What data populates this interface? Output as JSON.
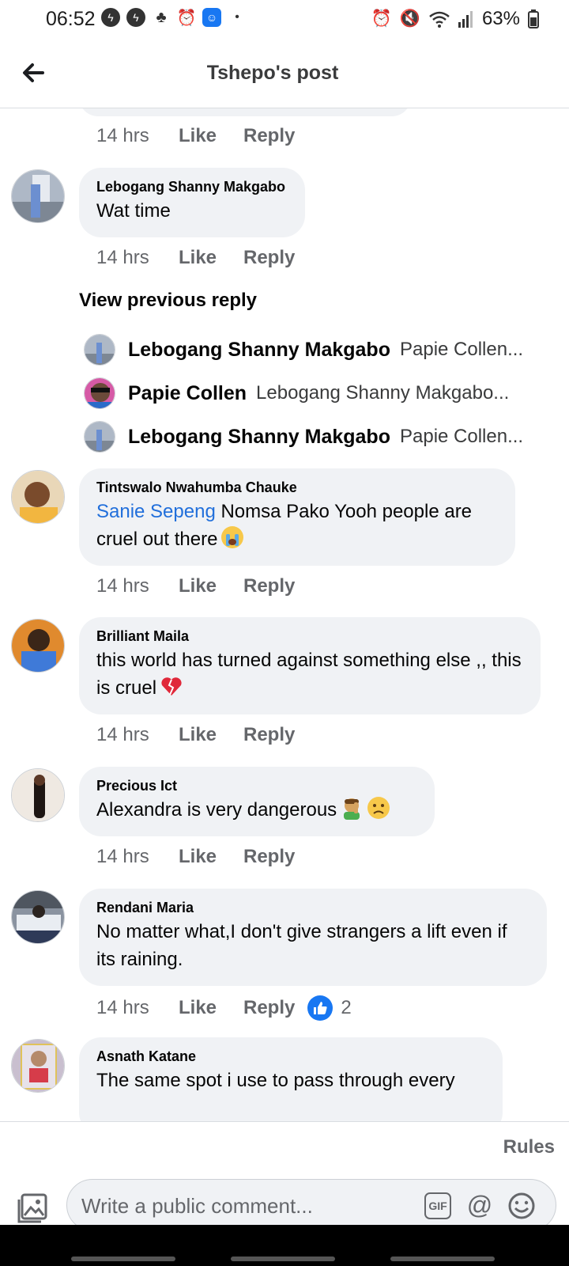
{
  "status_bar": {
    "time": "06:52",
    "battery": "63%",
    "left_icons": [
      "notification-icon",
      "notification-icon",
      "tree-icon",
      "alarm-icon",
      "facebook-icon",
      "dot-icon"
    ],
    "right_icons": [
      "alarm-icon",
      "mute-icon",
      "wifi-icon",
      "signal-icon",
      "battery-icon"
    ]
  },
  "header": {
    "title": "Tshepo's post",
    "back_icon": "back-arrow-icon"
  },
  "actions": {
    "like": "Like",
    "reply": "Reply"
  },
  "comments": [
    {
      "time": "14 hrs"
    },
    {
      "author": "Lebogang Shanny Makgabo",
      "text": "Wat time",
      "time": "14 hrs"
    },
    {
      "author": "Tintswalo Nwahumba Chauke",
      "mention": "Sanie Sepeng",
      "text": " Nomsa Pako Yooh people are cruel out there",
      "emoji": [
        "crying-face"
      ],
      "time": "14 hrs"
    },
    {
      "author": "Brilliant Maila",
      "text": "this world has turned against something else ,, this is cruel",
      "emoji": [
        "broken-heart"
      ],
      "time": "14 hrs"
    },
    {
      "author": "Precious Ict",
      "text": "Alexandra is very dangerous",
      "emoji": [
        "person-facepalming",
        "worried-face"
      ],
      "time": "14 hrs"
    },
    {
      "author": "Rendani Maria",
      "text": "No matter what,I don't give strangers a lift even if its raining.",
      "time": "14 hrs",
      "reaction": {
        "icon": "thumbs-up-icon",
        "count": "2"
      }
    },
    {
      "author": "Asnath Katane",
      "text": "The same spot i use to pass through every"
    }
  ],
  "view_previous": "View previous reply",
  "replies": [
    {
      "author": "Lebogang Shanny Makgabo",
      "preview": "Papie Collen..."
    },
    {
      "author": "Papie Collen",
      "preview": "Lebogang Shanny Makgabo..."
    },
    {
      "author": "Lebogang Shanny Makgabo",
      "preview": "Papie Collen..."
    }
  ],
  "composer": {
    "rules": "Rules",
    "placeholder": "Write a public comment...",
    "gif": "GIF",
    "mention": "@",
    "photo_icon": "photo-icon",
    "emoji_icon": "smiley-icon"
  },
  "colors": {
    "bubble": "#f0f2f5",
    "link": "#216fdb",
    "meta": "#65676b",
    "brand": "#1877f2"
  }
}
